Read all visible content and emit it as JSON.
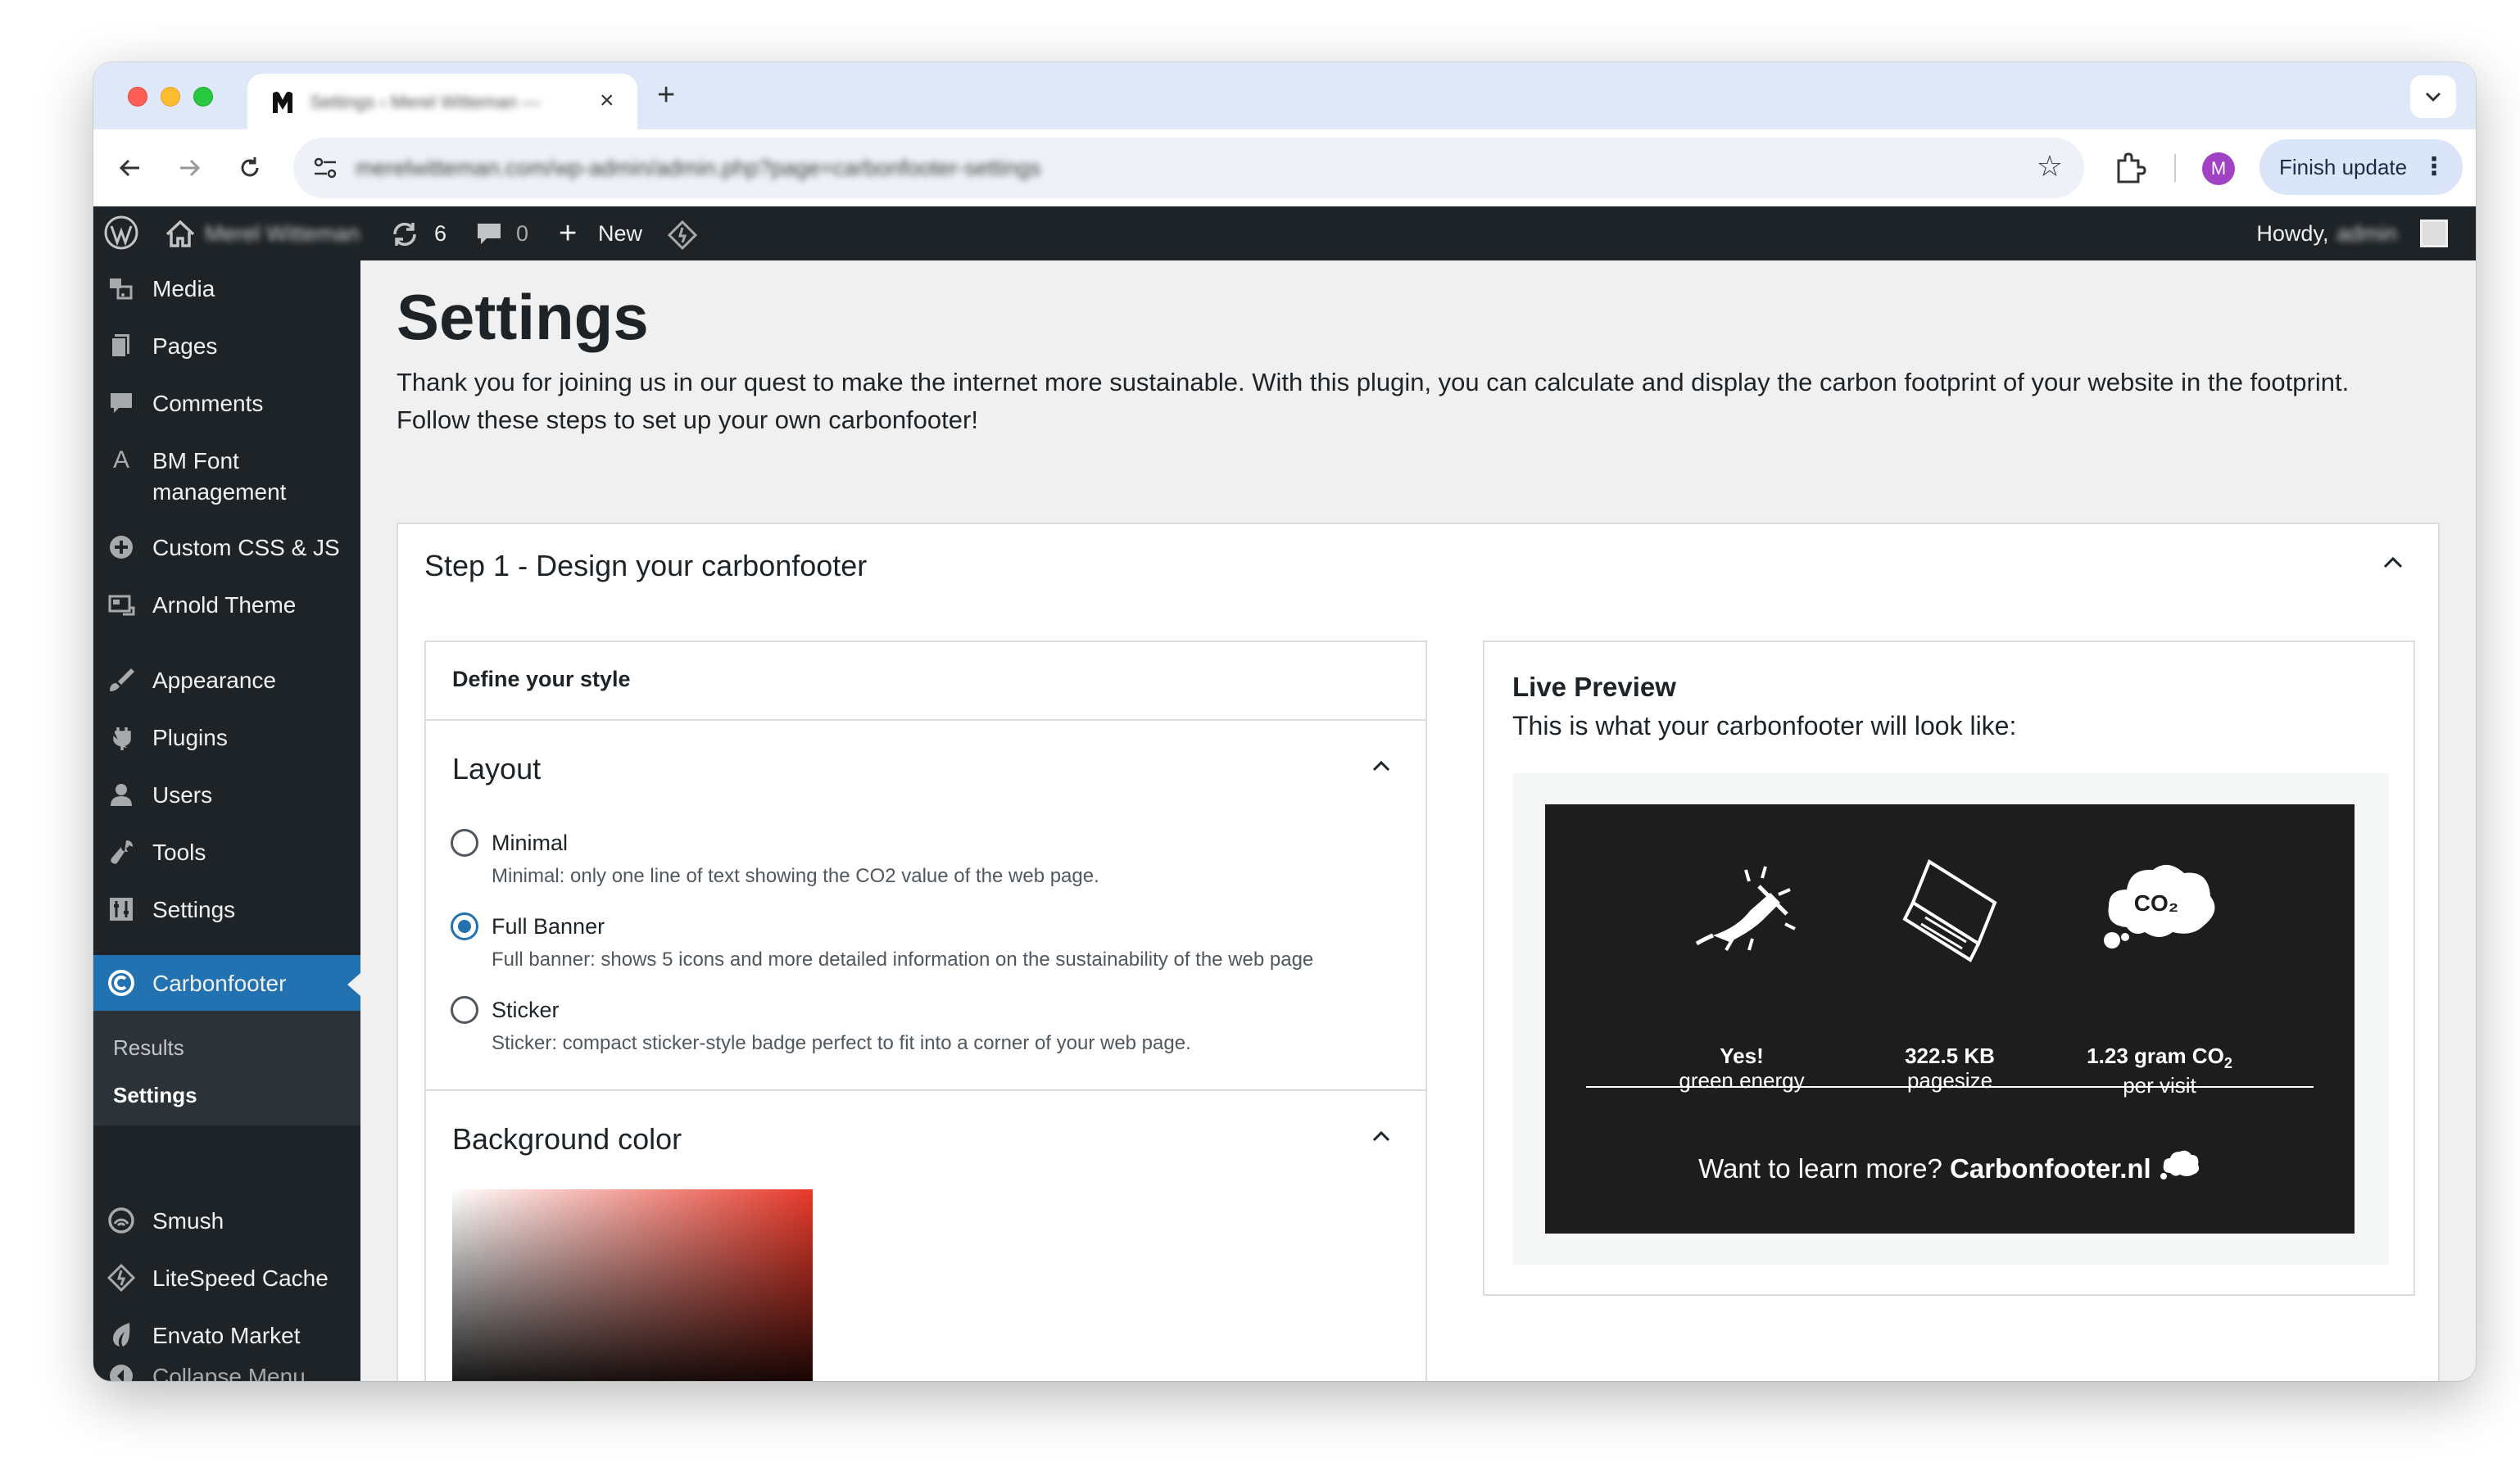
{
  "browser": {
    "tab_title": "Settings ‹ Merel Witteman —",
    "new_tab_icon": "+",
    "close_icon": "×",
    "url": "merelwitteman.com/wp-admin/admin.php?page=carbonfooter-settings",
    "profile_initial": "M",
    "finish_update_label": "Finish update"
  },
  "adminbar": {
    "site_name": "Merel Witteman",
    "updates_count": "6",
    "comments_count": "0",
    "new_label": "New",
    "howdy": "Howdy,",
    "username": "admin"
  },
  "sidebar": {
    "items": [
      {
        "label": "Media",
        "icon": "media-icon"
      },
      {
        "label": "Pages",
        "icon": "pages-icon"
      },
      {
        "label": "Comments",
        "icon": "comments-icon"
      },
      {
        "label": "BM Font",
        "label2": "management",
        "icon": "font-icon"
      },
      {
        "label": "Custom CSS & JS",
        "icon": "plus-circle-icon"
      },
      {
        "label": "Arnold Theme",
        "icon": "theme-icon"
      },
      {
        "label": "Appearance",
        "icon": "brush-icon"
      },
      {
        "label": "Plugins",
        "icon": "plugin-icon"
      },
      {
        "label": "Users",
        "icon": "user-icon"
      },
      {
        "label": "Tools",
        "icon": "wrench-icon"
      },
      {
        "label": "Settings",
        "icon": "settings-icon"
      },
      {
        "label": "Carbonfooter",
        "icon": "carbonfooter-icon"
      },
      {
        "label": "Smush",
        "icon": "smush-icon"
      },
      {
        "label": "LiteSpeed Cache",
        "icon": "litespeed-icon"
      },
      {
        "label": "Envato Market",
        "icon": "envato-icon"
      }
    ],
    "submenu": [
      "Results",
      "Settings"
    ],
    "collapse_label": "Collapse Menu"
  },
  "main": {
    "title": "Settings",
    "intro": "Thank you for joining us in our quest to make the internet more sustainable. With this plugin, you can calculate and display the carbon footprint of your website in the footprint. Follow these steps to set up your own carbonfooter!",
    "step1_title": "Step 1 - Design your carbonfooter",
    "style_header": "Define your style",
    "layout_title": "Layout",
    "layout_options": [
      {
        "label": "Minimal",
        "desc": "Minimal: only one line of text showing the CO2 value of the web page.",
        "checked": false
      },
      {
        "label": "Full Banner",
        "desc": "Full banner: shows 5 icons and more detailed information on the sustainability of the web page",
        "checked": true
      },
      {
        "label": "Sticker",
        "desc": "Sticker: compact sticker-style badge perfect to fit into a corner of your web page.",
        "checked": false
      }
    ],
    "bg_color_title": "Background color",
    "preview_title": "Live Preview",
    "preview_sub": "This is what your carbonfooter will look like:"
  },
  "banner": {
    "stat1_strong": "Yes!",
    "stat1_sub": "green energy",
    "stat2_strong": "322.5 KB",
    "stat2_sub": "pagesize",
    "stat3_strong": "1.23 gram CO",
    "stat3_sub2": "2",
    "stat3_sub": "per visit",
    "cloud_text": "CO₂",
    "cta_text": "Want to learn more?",
    "cta_brand": "Carbonfooter.nl"
  },
  "colors": {
    "wp_dark": "#1d2327",
    "wp_blue": "#2271b1",
    "banner_bg": "#1d1d1d",
    "picker_red": "#e8392a"
  }
}
